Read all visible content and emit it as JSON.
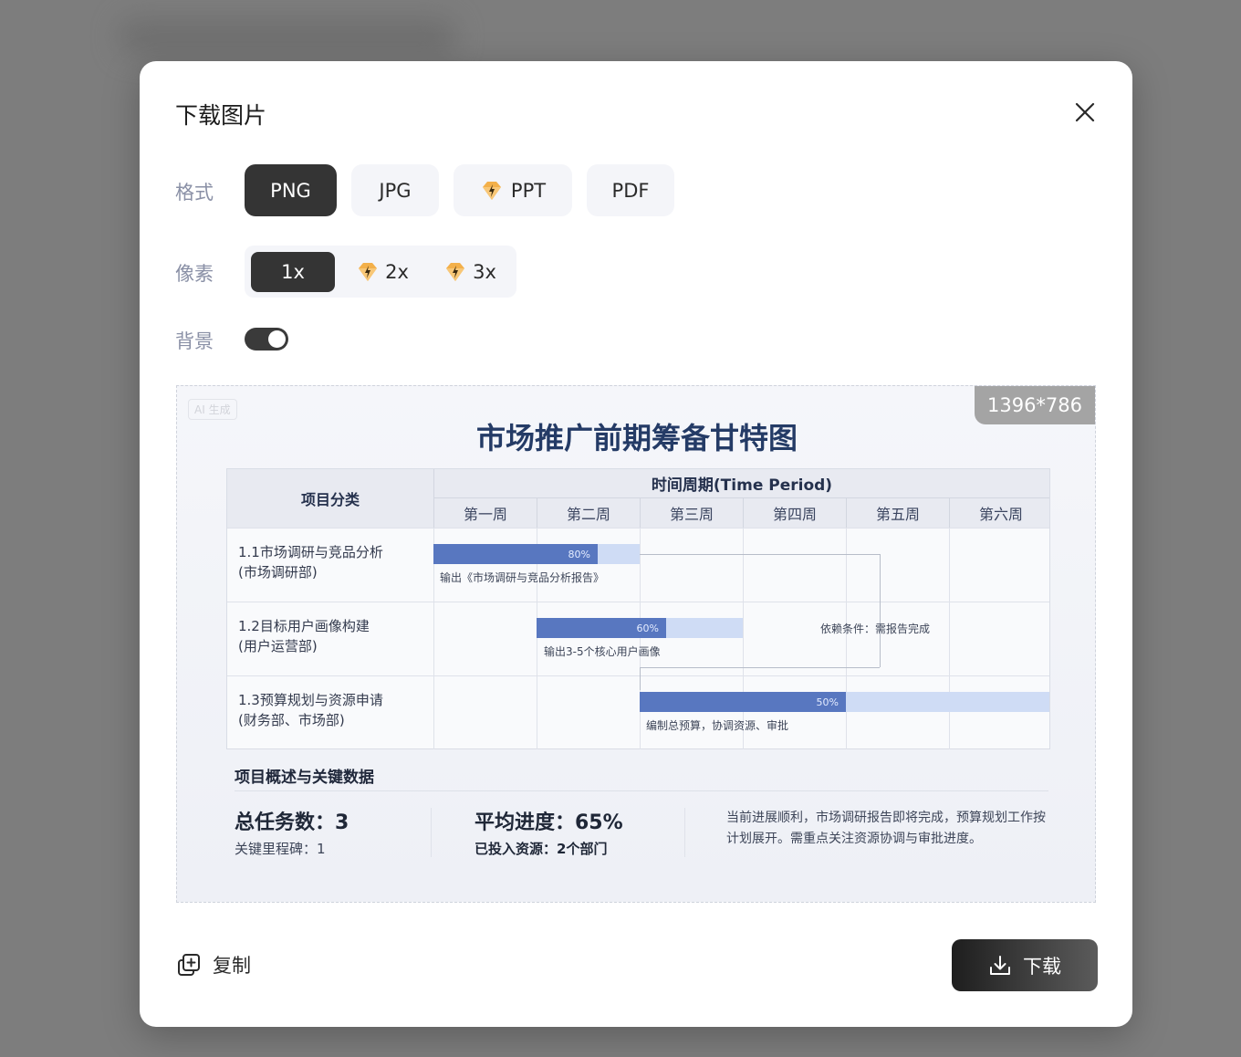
{
  "dialog": {
    "title": "下载图片",
    "format_label": "格式",
    "formats": [
      "PNG",
      "JPG",
      "PPT",
      "PDF"
    ],
    "selected_format": "PNG",
    "scale_label": "像素",
    "scales": [
      "1x",
      "2x",
      "3x"
    ],
    "selected_scale": "1x",
    "background_label": "背景",
    "background_enabled": true,
    "copy_label": "复制",
    "download_label": "下载"
  },
  "preview": {
    "dimensions": "1396*786",
    "watermark": "AI 生成",
    "title": "市场推广前期筹备甘特图",
    "category_header": "项目分类",
    "period_header": "时间周期(Time Period)",
    "weeks": [
      "第一周",
      "第二周",
      "第三周",
      "第四周",
      "第五周",
      "第六周"
    ],
    "tasks": [
      {
        "line1": "1.1市场调研与竞品分析",
        "line2": "(市场调研部)",
        "progress": "80%",
        "note": "输出《市场调研与竞品分析报告》"
      },
      {
        "line1": "1.2目标用户画像构建",
        "line2": "(用户运营部)",
        "progress": "60%",
        "note": "输出3-5个核心用户画像"
      },
      {
        "line1": "1.3预算规划与资源申请",
        "line2": "(财务部、市场部)",
        "progress": "50%",
        "note": "编制总预算，协调资源、审批"
      }
    ],
    "dependency_note": "依赖条件：需报告完成",
    "summary_title": "项目概述与关键数据",
    "total_tasks": "总任务数：3",
    "milestones": "关键里程碑：1",
    "avg_progress": "平均进度：65%",
    "resources": "已投入资源：2个部门",
    "description": "当前进展顺利，市场调研报告即将完成，预算规划工作按计划展开。需重点关注资源协调与审批进度。"
  },
  "colors": {
    "primary_dark": "#343434",
    "bar_fill": "#5877c0",
    "bar_track": "#cfdcf5",
    "label_gray": "#8a90a6",
    "premium_gold": "#f3b04a"
  },
  "icons": [
    "close-icon",
    "premium-diamond-icon",
    "copy-icon",
    "download-icon"
  ]
}
